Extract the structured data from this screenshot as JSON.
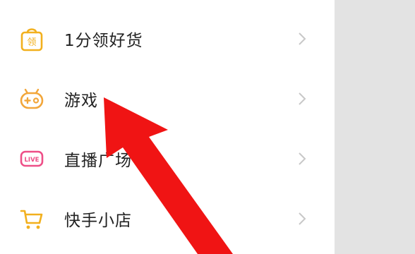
{
  "menu": {
    "items": [
      {
        "label": "1分领好货",
        "icon": "shopping-bag-icon",
        "icon_text": "领",
        "color": "#F2B01E"
      },
      {
        "label": "游戏",
        "icon": "gamepad-icon",
        "color": "#F2A63A"
      },
      {
        "label": "直播广场",
        "icon": "live-badge-icon",
        "icon_text": "LIVE",
        "color": "#EE4E87"
      },
      {
        "label": "快手小店",
        "icon": "shopping-cart-icon",
        "color": "#F2B01E"
      }
    ]
  },
  "overlay": {
    "arrow_color": "#F01414"
  }
}
